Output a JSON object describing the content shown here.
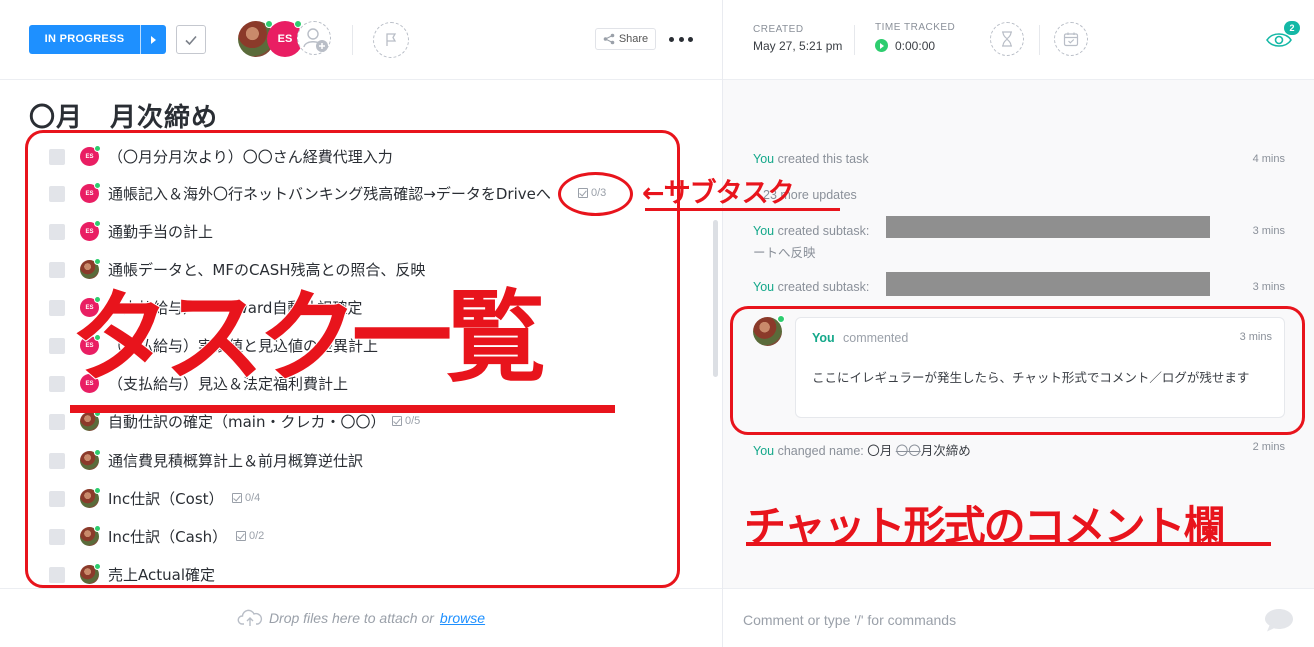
{
  "header": {
    "status_label": "IN PROGRESS",
    "assignee_initials": "ES",
    "share_label": "Share"
  },
  "title": "〇月　月次締め",
  "tasks": [
    {
      "name": "（〇月分月次より）〇〇さん経費代理入力",
      "avatar": "ES",
      "subtasks": ""
    },
    {
      "name": "通帳記入＆海外〇行ネットバンキング残高確認→データをDriveへ",
      "avatar": "ES",
      "subtasks": "0/3"
    },
    {
      "name": "通勤手当の計上",
      "avatar": "ES",
      "subtasks": ""
    },
    {
      "name": "通帳データと、MFのCASH残高との照合、反映",
      "avatar": "photo",
      "subtasks": ""
    },
    {
      "name": "（支払給与）　　　ward自動仕訳確定",
      "avatar": "ES",
      "subtasks": ""
    },
    {
      "name": "（支払給与）実績値と見込値の差異計上",
      "avatar": "ES",
      "subtasks": ""
    },
    {
      "name": "（支払給与）見込＆法定福利費計上",
      "avatar": "ES",
      "subtasks": ""
    },
    {
      "name": "自動仕訳の確定（main・クレカ・〇〇）",
      "avatar": "photo",
      "subtasks": "0/5"
    },
    {
      "name": "通信費見積概算計上＆前月概算逆仕訳",
      "avatar": "photo",
      "subtasks": ""
    },
    {
      "name": "Inc仕訳（Cost）",
      "avatar": "photo",
      "subtasks": "0/4"
    },
    {
      "name": "Inc仕訳（Cash）",
      "avatar": "photo",
      "subtasks": "0/2"
    },
    {
      "name": "売上Actual確定",
      "avatar": "photo",
      "subtasks": ""
    }
  ],
  "dropzone": {
    "text": "Drop files here to attach or",
    "link": "browse"
  },
  "meta": {
    "created_label": "CREATED",
    "created_value": "May 27, 5:21 pm",
    "tracked_label": "TIME TRACKED",
    "tracked_value": "0:00:00",
    "watchers_count": "2"
  },
  "activity": {
    "you": "You",
    "created_task": "created this task",
    "created_task_time": "4 mins",
    "more_updates": "23 more updates",
    "subtask1_text": "created subtask:",
    "subtask1_line2": "ートへ反映",
    "subtask1_time": "3 mins",
    "subtask2_text": "created subtask:",
    "subtask2_time": "3 mins",
    "changed_name_text": "changed name:",
    "changed_name_new": "〇月",
    "changed_name_old": "〇〇",
    "changed_name_rest": "月次締め",
    "changed_name_time": "2 mins"
  },
  "comment": {
    "author": "You",
    "verb": "commented",
    "time": "3 mins",
    "body": "ここにイレギュラーが発生したら、チャット形式でコメント／ログが残せます"
  },
  "comment_input": {
    "placeholder": "Comment or type '/' for commands"
  },
  "annotations": {
    "subtask_label": "←サブタスク",
    "task_list_label": "タスク一覧",
    "chat_label": "チャット形式のコメント欄"
  },
  "colors": {
    "status_blue": "#1e90ff",
    "accent_teal": "#14a88a",
    "annotation_red": "#e8141c",
    "es_pink": "#e91e63"
  }
}
